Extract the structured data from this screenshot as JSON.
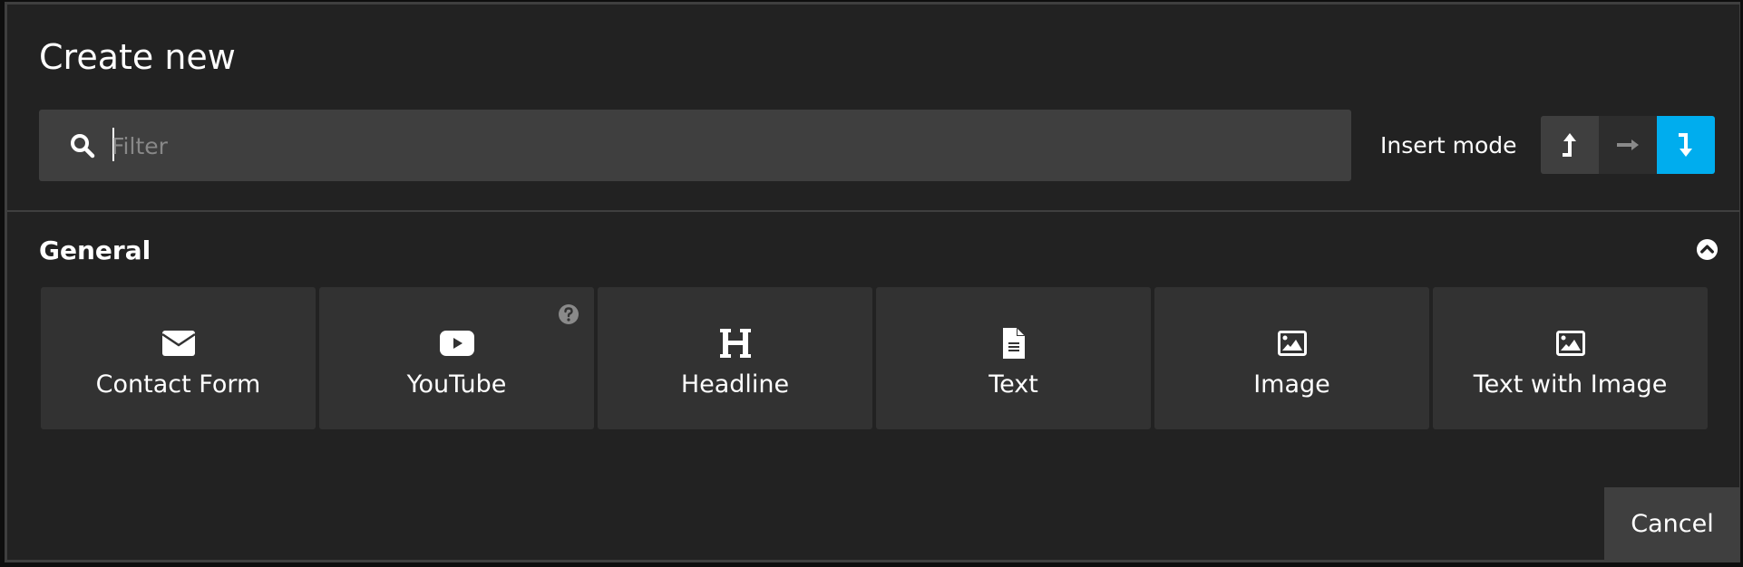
{
  "dialog": {
    "title": "Create new"
  },
  "filter": {
    "placeholder": "Filter",
    "value": "",
    "icon": "search-icon"
  },
  "insert_mode": {
    "label": "Insert mode",
    "options": [
      {
        "name": "before",
        "icon": "insert-before-icon",
        "active": false
      },
      {
        "name": "into",
        "icon": "insert-into-icon",
        "active": false
      },
      {
        "name": "after",
        "icon": "insert-after-icon",
        "active": true
      }
    ],
    "active_color": "#00adee"
  },
  "section": {
    "title": "General",
    "collapse_icon": "chevron-up-circle-icon",
    "items": [
      {
        "label": "Contact Form",
        "icon": "envelope-icon",
        "help": false
      },
      {
        "label": "YouTube",
        "icon": "youtube-icon",
        "help": true
      },
      {
        "label": "Headline",
        "icon": "heading-icon",
        "help": false
      },
      {
        "label": "Text",
        "icon": "file-text-icon",
        "help": false
      },
      {
        "label": "Image",
        "icon": "image-icon",
        "help": false
      },
      {
        "label": "Text with Image",
        "icon": "image-icon",
        "help": false
      }
    ]
  },
  "footer": {
    "cancel_label": "Cancel"
  }
}
